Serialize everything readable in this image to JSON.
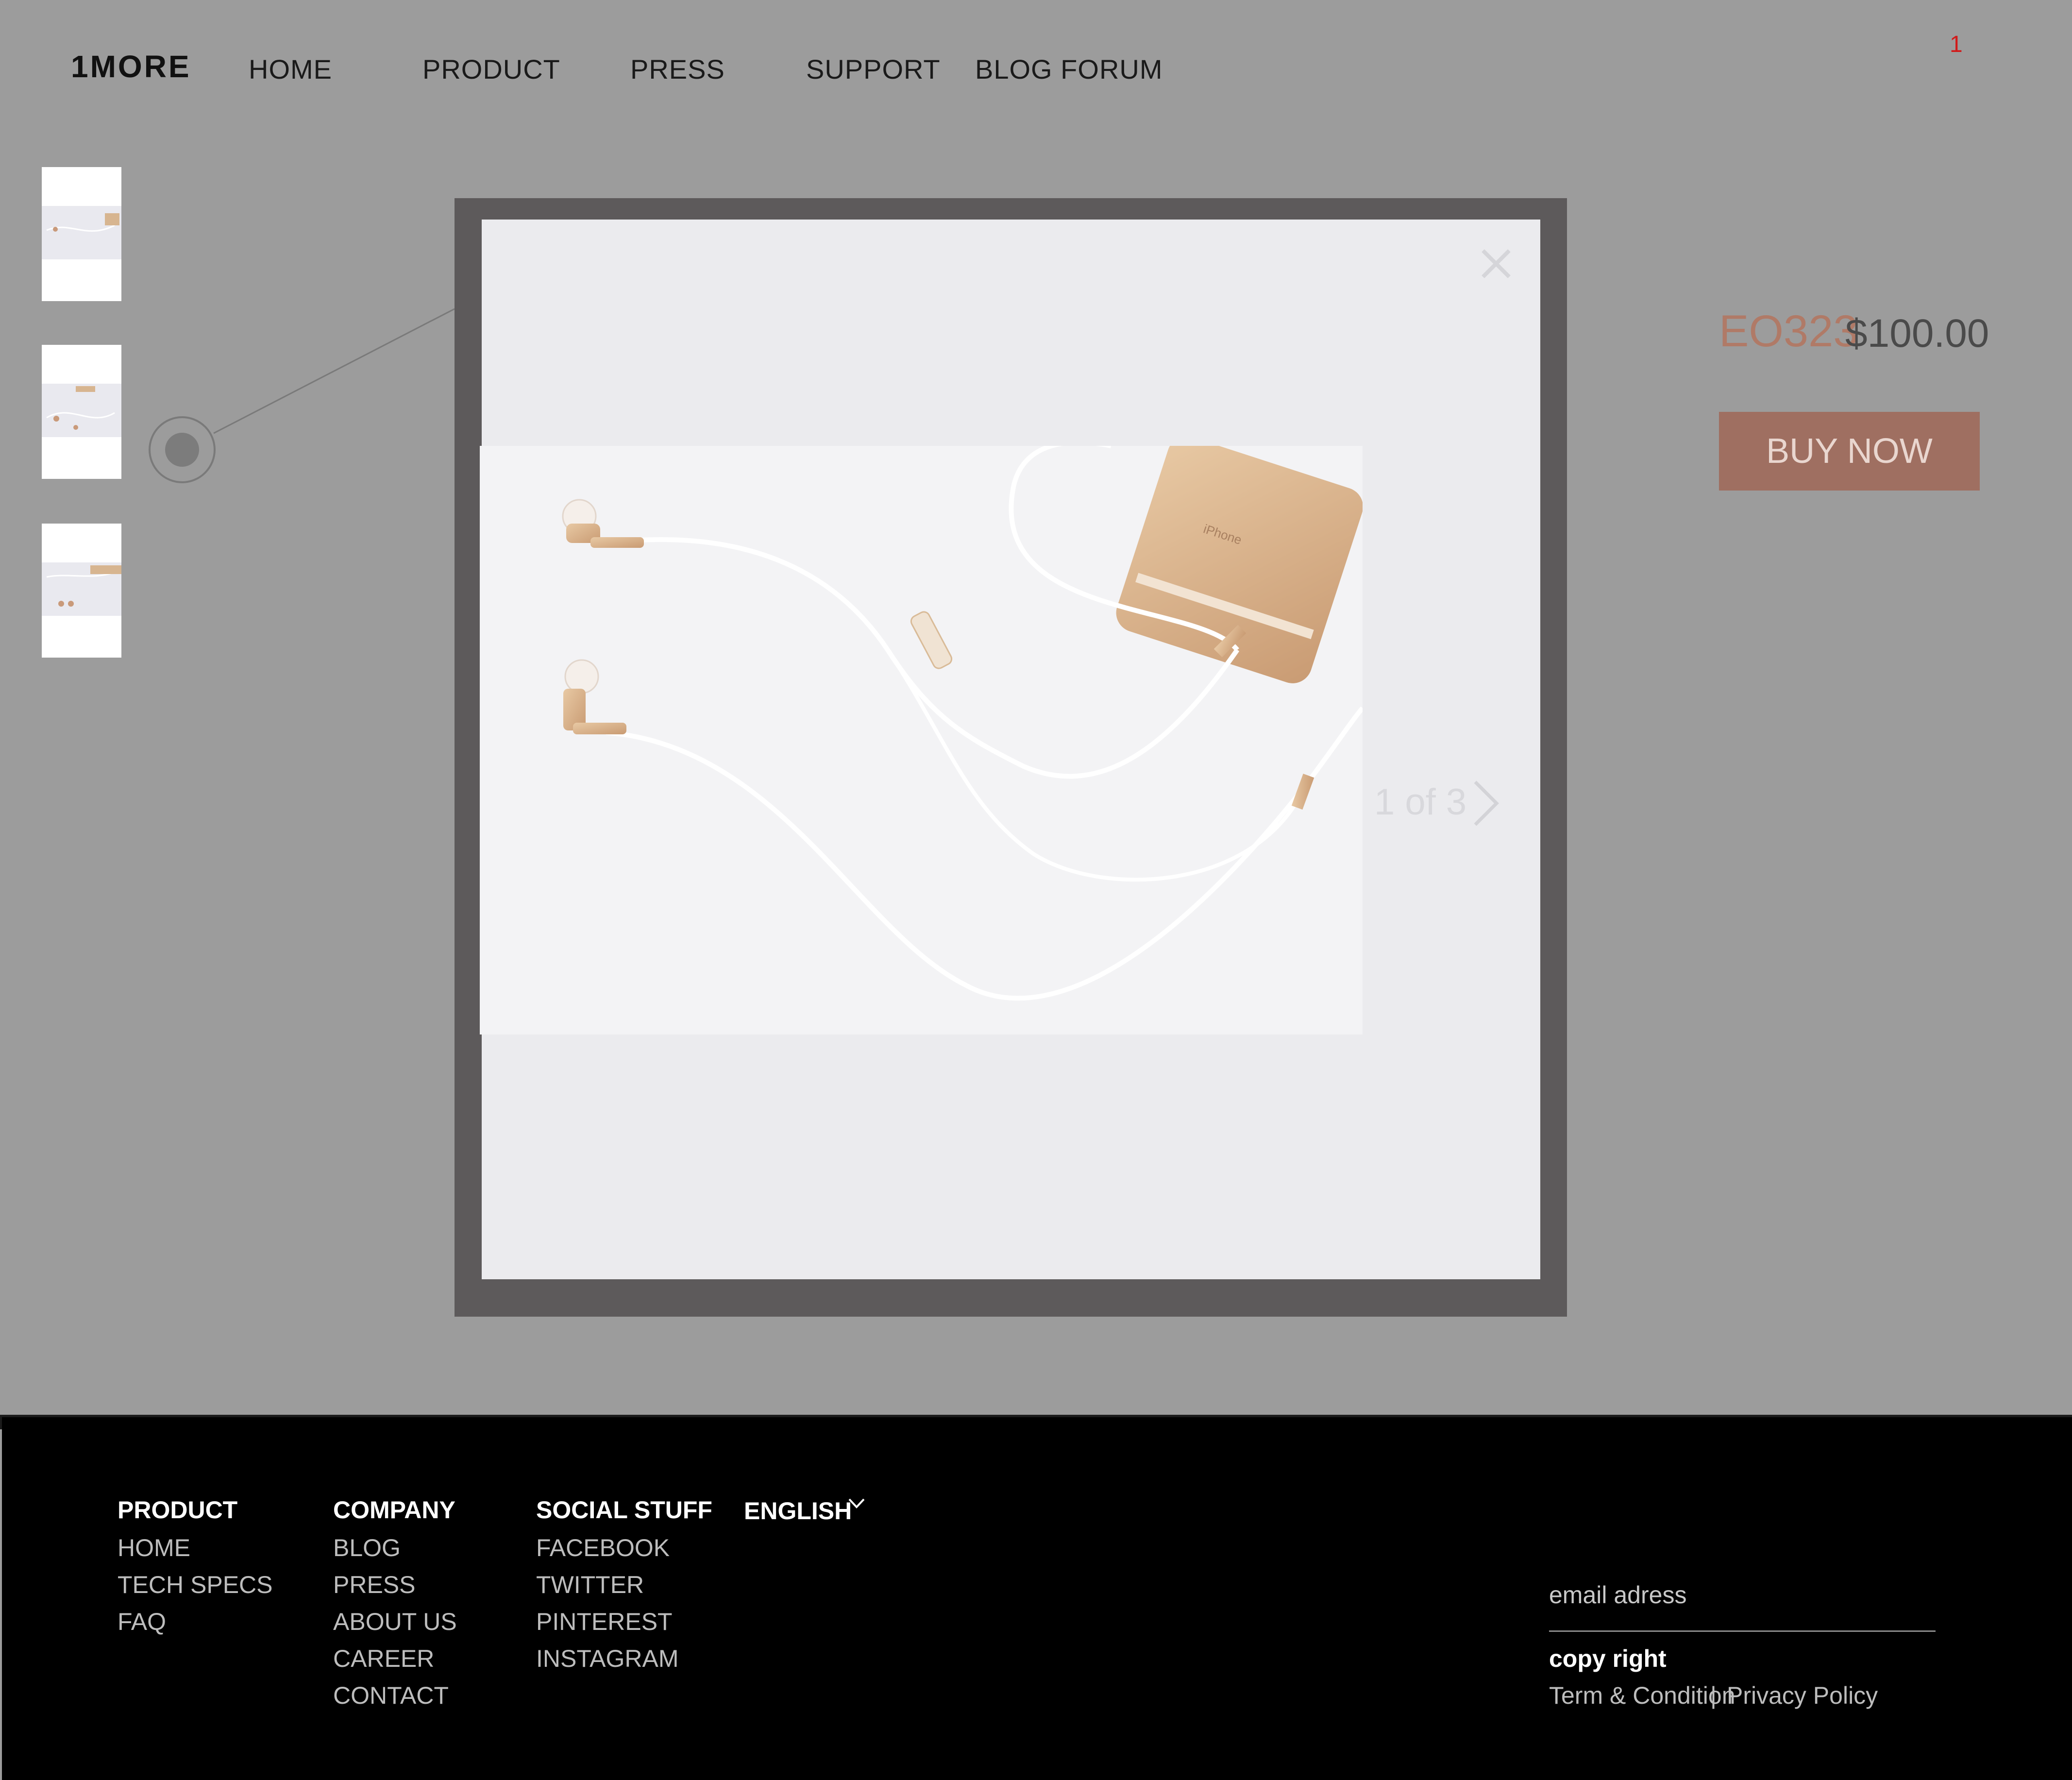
{
  "header": {
    "logo": "1MORE",
    "nav": [
      "HOME",
      "PRODUCT",
      "PRESS",
      "SUPPORT",
      "BLOG FORUM"
    ],
    "cart_count": "1"
  },
  "product": {
    "code": "EO323",
    "price": "$100.00",
    "buy_label": "BUY NOW"
  },
  "gallery": {
    "pager": "1 of 3",
    "thumbnail_count": 3
  },
  "footer": {
    "product": {
      "heading": "PRODUCT",
      "links": [
        "HOME",
        "TECH SPECS",
        "FAQ"
      ]
    },
    "company": {
      "heading": "COMPANY",
      "links": [
        "BLOG",
        "PRESS",
        "ABOUT US",
        "CAREER",
        "CONTACT"
      ]
    },
    "social": {
      "heading": "SOCIAL STUFF",
      "links": [
        "FACEBOOK",
        "TWITTER",
        "PINTEREST",
        "INSTAGRAM"
      ]
    },
    "language": "ENGLISH",
    "email_placeholder": "email adress",
    "copyright": "copy right",
    "terms": "Term & Condition",
    "separator": "|",
    "privacy": "Privacy Policy"
  },
  "colors": {
    "overlay_bg": "#9c9c9c",
    "accent": "#9f6f61",
    "code_color": "#b07a67",
    "modal_frame": "#5d5a5b",
    "footer_bg": "#000000"
  },
  "icons": [
    "close-icon",
    "chevron-right-icon",
    "chevron-down-icon",
    "hotspot-icon"
  ]
}
